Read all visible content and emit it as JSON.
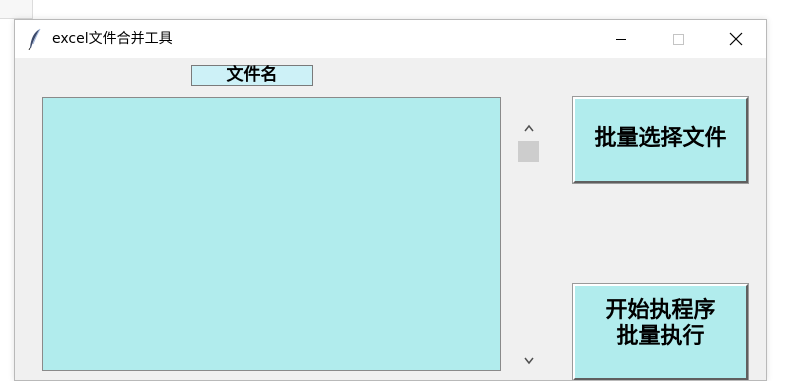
{
  "window": {
    "title": "excel文件合并工具",
    "icon": "feather-icon"
  },
  "titlebar_buttons": [
    "minimize-icon",
    "maximize-icon",
    "close-icon"
  ],
  "list": {
    "header": "文件名",
    "items": []
  },
  "buttons": {
    "select_files": "批量选择文件",
    "run_line1": "开始执程序",
    "run_line2": "批量执行"
  },
  "colors": {
    "accent_cyan": "#b1eced",
    "header_bg": "#cdf1f7",
    "window_bg": "#f0f0f0"
  }
}
